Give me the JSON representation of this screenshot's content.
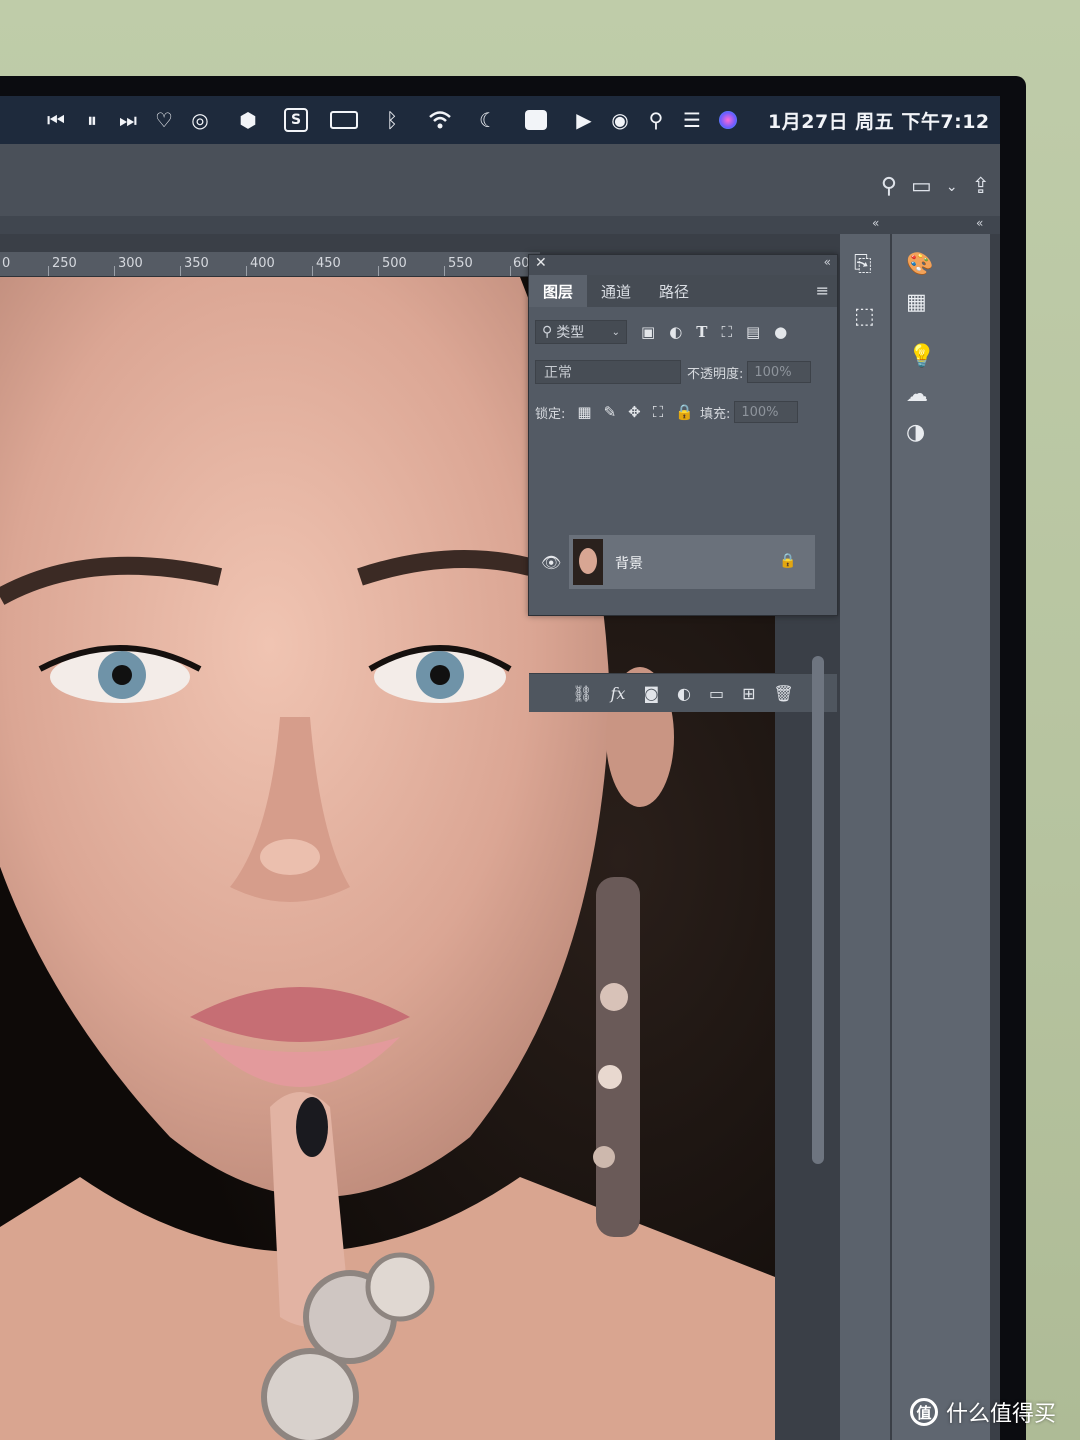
{
  "menubar": {
    "icons": [
      "previous-track-icon",
      "pause-icon",
      "next-track-icon",
      "heart-icon",
      "spiral-icon",
      "hexagon-icon",
      "s-app-icon",
      "battery-icon",
      "bluetooth-icon",
      "wifi-icon",
      "moon-icon",
      "photos-icon",
      "play-circle-icon",
      "user-circle-icon",
      "search-icon",
      "control-center-icon",
      "siri-icon"
    ],
    "clock": "1月27日 周五 下午7:12"
  },
  "ruler": {
    "ticks": [
      "0",
      "250",
      "300",
      "350",
      "400",
      "450",
      "500",
      "550",
      "60"
    ]
  },
  "layers_panel": {
    "tabs": [
      {
        "label": "图层",
        "active": true
      },
      {
        "label": "通道",
        "active": false
      },
      {
        "label": "路径",
        "active": false
      }
    ],
    "filter_kind": "类型",
    "blend_mode": "正常",
    "opacity_label": "不透明度:",
    "opacity_value": "100%",
    "lock_label": "锁定:",
    "fill_label": "填充:",
    "fill_value": "100%",
    "layer": {
      "name": "背景",
      "locked": true,
      "visible": true
    }
  },
  "watermark": {
    "text": "什么值得买",
    "logo_glyph": "值"
  },
  "colors": {
    "menubar_bg": "#1e2a3c",
    "panel_bg": "#535a64",
    "selected_layer_bg": "#6a717b",
    "wall": "#b9c7a3"
  }
}
